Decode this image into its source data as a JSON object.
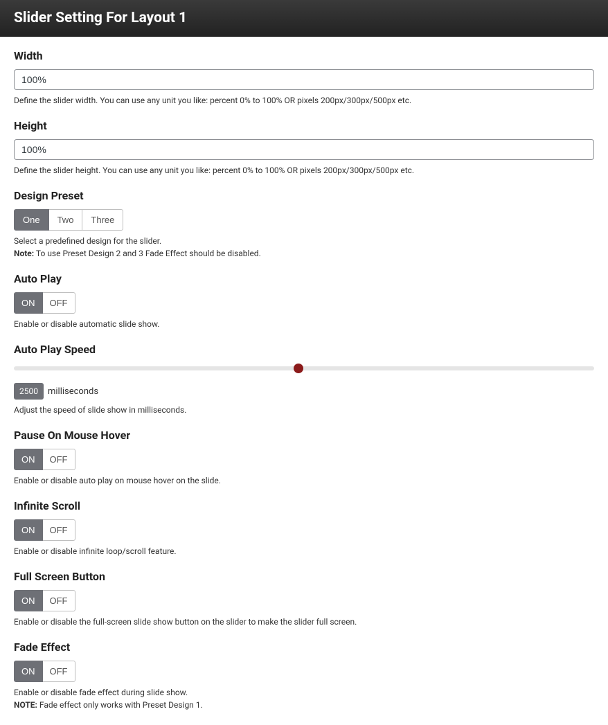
{
  "header": {
    "title": "Slider Setting For Layout 1"
  },
  "width": {
    "label": "Width",
    "value": "100%",
    "helper": "Define the slider width. You can use any unit you like: percent 0% to 100% OR pixels 200px/300px/500px etc."
  },
  "height": {
    "label": "Height",
    "value": "100%",
    "helper": "Define the slider height. You can use any unit you like: percent 0% to 100% OR pixels 200px/300px/500px etc."
  },
  "design_preset": {
    "label": "Design Preset",
    "options": {
      "one": "One",
      "two": "Two",
      "three": "Three"
    },
    "helper": "Select a predefined design for the slider.",
    "note_label": "Note:",
    "note_text": " To use Preset Design 2 and 3 Fade Effect should be disabled."
  },
  "auto_play": {
    "label": "Auto Play",
    "on": "ON",
    "off": "OFF",
    "helper": "Enable or disable automatic slide show."
  },
  "auto_play_speed": {
    "label": "Auto Play Speed",
    "value": "2500",
    "unit": "milliseconds",
    "thumb_pct": "49%",
    "helper": "Adjust the speed of slide show in milliseconds."
  },
  "pause_hover": {
    "label": "Pause On Mouse Hover",
    "on": "ON",
    "off": "OFF",
    "helper": "Enable or disable auto play on mouse hover on the slide."
  },
  "infinite_scroll": {
    "label": "Infinite Scroll",
    "on": "ON",
    "off": "OFF",
    "helper": "Enable or disable infinite loop/scroll feature."
  },
  "fullscreen": {
    "label": "Full Screen Button",
    "on": "ON",
    "off": "OFF",
    "helper": "Enable or disable the full-screen slide show button on the slider to make the slider full screen."
  },
  "fade_effect": {
    "label": "Fade Effect",
    "on": "ON",
    "off": "OFF",
    "helper": "Enable or disable fade effect during slide show.",
    "note_label": "NOTE:",
    "note_text": " Fade effect only works with Preset Design 1."
  }
}
